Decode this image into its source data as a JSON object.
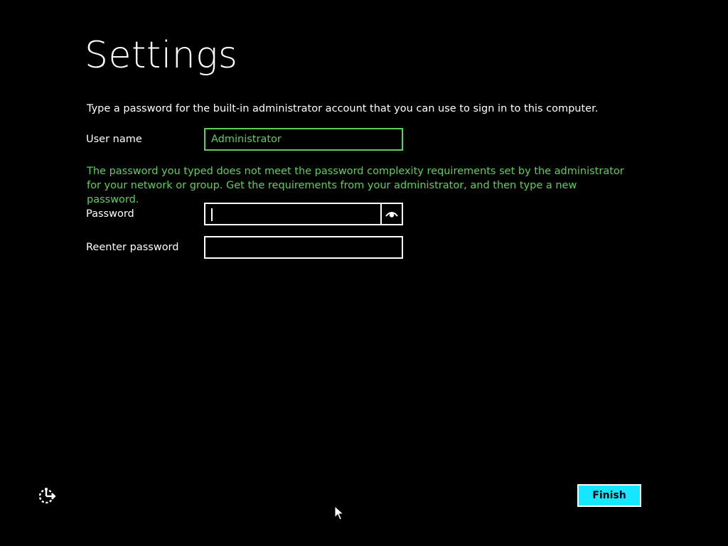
{
  "page": {
    "title": "Settings",
    "instructions": "Type a password for the built-in administrator account that you can use to sign in to this computer."
  },
  "form": {
    "username": {
      "label": "User name",
      "value": "Administrator"
    },
    "error_message": "The password you typed does not meet the password complexity requirements set by the administrator for your network or group. Get the requirements from your administrator, and then type a new password.",
    "password": {
      "label": "Password",
      "value": ""
    },
    "reenter_password": {
      "label": "Reenter password",
      "value": ""
    }
  },
  "footer": {
    "finish_label": "Finish",
    "ease_of_access_icon": "ease-of-access-icon"
  },
  "colors": {
    "background": "#000000",
    "text": "#ffffff",
    "accent_green": "#5dcf5b",
    "button_cyan": "#16e6ff"
  },
  "icons": {
    "reveal_password": "eye-icon",
    "ease_of_access": "ease-of-access-icon",
    "mouse_pointer": "mouse-pointer-icon"
  }
}
